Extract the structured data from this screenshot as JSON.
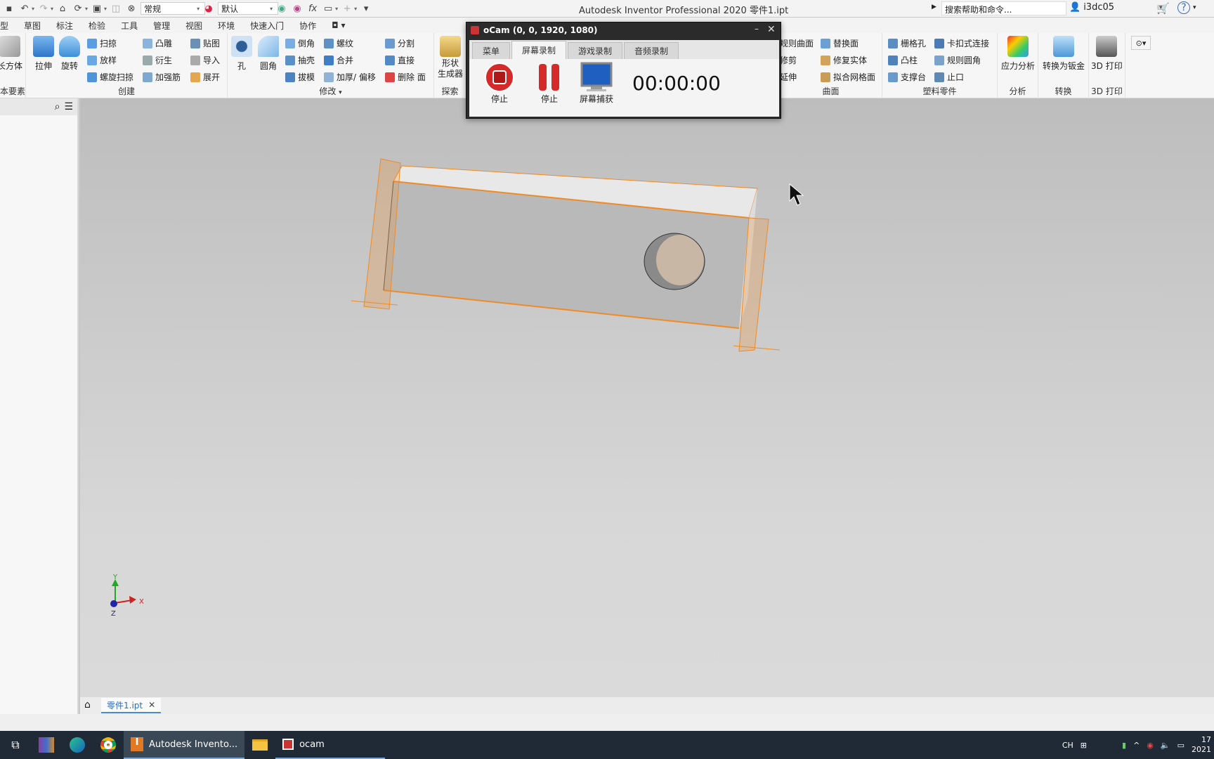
{
  "window": {
    "title": "Autodesk Inventor Professional 2020    零件1.ipt"
  },
  "qat": {
    "style_select": "常规",
    "appearance_select": "默认",
    "help_search": "搜索帮助和命令...",
    "user": "i3dc05"
  },
  "ribbon_tabs": [
    "型",
    "草图",
    "标注",
    "检验",
    "工具",
    "管理",
    "视图",
    "环境",
    "快速入门",
    "协作"
  ],
  "ribbon": {
    "primitives": {
      "title": "本要素",
      "box": "长方体"
    },
    "create": {
      "title": "创建",
      "extrude": "拉伸",
      "revolve": "旋转",
      "sweep": "扫掠",
      "loft": "放样",
      "coil": "螺旋扫掠",
      "emboss": "凸雕",
      "derive": "衍生",
      "rib": "加强筋",
      "decal": "贴图",
      "import": "导入",
      "unwrap": "展开"
    },
    "modify": {
      "title": "修改",
      "hole": "孔",
      "fillet": "圆角",
      "chamfer": "倒角",
      "shell": "抽壳",
      "draft": "拔模",
      "thread": "螺纹",
      "combine": "合并",
      "thicken": "加厚/ 偏移",
      "split": "分割",
      "direct": "直接",
      "delete_face": "删除 面"
    },
    "explore": {
      "title": "探索",
      "shape_gen": "形状\n生成器"
    },
    "surface": {
      "title": "曲面",
      "ruled": "规则曲面",
      "trim": "修剪",
      "extend": "延伸",
      "replace": "替换面",
      "repair": "修复实体",
      "fit_mesh": "拟合网格面"
    },
    "plastic": {
      "title": "塑料零件",
      "grill": "栅格孔",
      "snap_fit": "卡扣式连接",
      "boss": "凸柱",
      "rule_fillet": "规则圆角",
      "rest": "支撑台",
      "lip": "止口"
    },
    "analysis": {
      "title": "分析",
      "stress": "应力分析"
    },
    "convert": {
      "title": "转换",
      "to_sheet": "转换为钣金"
    },
    "print3d": {
      "title": "3D 打印",
      "print": "3D 打印"
    }
  },
  "viewport": {
    "triad": {
      "x": "X",
      "y": "Y",
      "z": "Z"
    },
    "document_tab": "零件1.ipt"
  },
  "ocam": {
    "title": "oCam (0, 0, 1920, 1080)",
    "tabs": [
      "菜单",
      "屏幕录制",
      "游戏录制",
      "音频录制"
    ],
    "active_tab": "屏幕录制",
    "stop_label": "停止",
    "pause_label": "停止",
    "capture_label": "屏幕捕获",
    "timer": "00:00:00"
  },
  "taskbar": {
    "apps": [
      {
        "label": "Autodesk Invento..."
      },
      {
        "label": "ocam"
      }
    ],
    "tray": {
      "ime": "CH",
      "clock_time": "17",
      "clock_date": "2021"
    }
  },
  "colors": {
    "selection": "#f08a24",
    "ocam_record": "#d42a2a",
    "ribbon_blue": "#3d8fd8"
  }
}
